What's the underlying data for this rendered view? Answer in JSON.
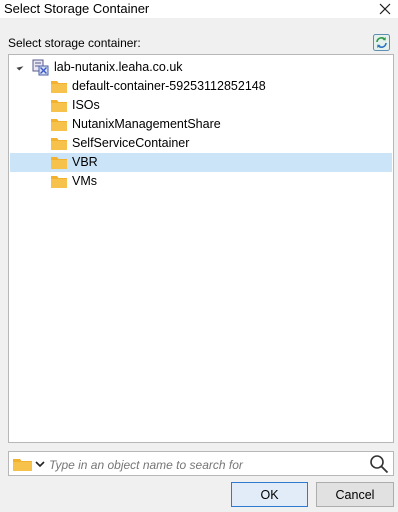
{
  "dialog": {
    "title": "Select Storage Container",
    "close_icon": "close-icon"
  },
  "prompt": {
    "label": "Select storage container:",
    "refresh_icon": "refresh-icon"
  },
  "tree": {
    "root": {
      "label": "lab-nutanix.leaha.co.uk",
      "icon": "cluster-server-icon",
      "expanded": true
    },
    "items": [
      {
        "label": "default-container-59253112852148",
        "icon": "folder-icon",
        "selected": false
      },
      {
        "label": "ISOs",
        "icon": "folder-icon",
        "selected": false
      },
      {
        "label": "NutanixManagementShare",
        "icon": "folder-icon",
        "selected": false
      },
      {
        "label": "SelfServiceContainer",
        "icon": "folder-icon",
        "selected": false
      },
      {
        "label": "VBR",
        "icon": "folder-icon",
        "selected": true
      },
      {
        "label": "VMs",
        "icon": "folder-icon",
        "selected": false
      }
    ]
  },
  "search": {
    "placeholder": "Type in an object name to search for",
    "value": "",
    "type_icon": "folder-icon",
    "search_icon": "search-icon"
  },
  "buttons": {
    "ok_label": "OK",
    "cancel_label": "Cancel"
  },
  "colors": {
    "selection": "#cce4f7",
    "folder": "#f2b12f",
    "ok_border": "#2f7ad1",
    "background": "#f0f0f0"
  }
}
